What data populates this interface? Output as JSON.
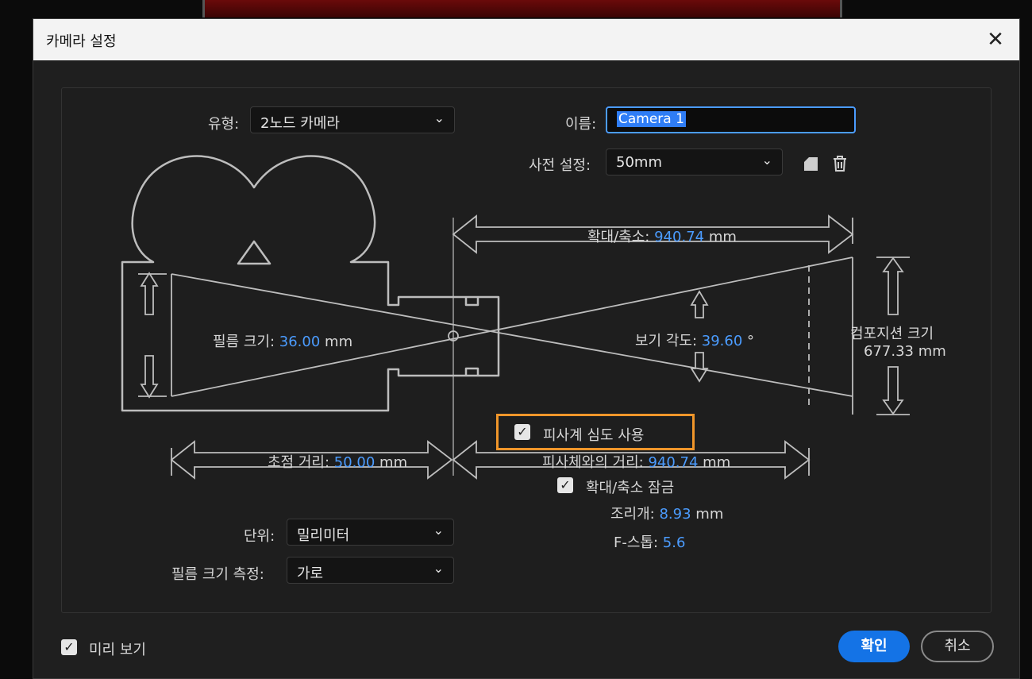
{
  "dialog": {
    "title": "카메라 설정",
    "close_glyph": "✕"
  },
  "type": {
    "label": "유형:",
    "value": "2노드 카메라"
  },
  "name": {
    "label": "이름:",
    "value": "Camera 1"
  },
  "preset": {
    "label": "사전 설정:",
    "value": "50mm"
  },
  "zoom": {
    "label": "확대/축소:",
    "value": "940.74",
    "unit": "mm"
  },
  "film_size": {
    "label": "필름 크기:",
    "value": "36.00",
    "unit": "mm"
  },
  "angle_of_view": {
    "label": "보기 각도:",
    "value": "39.60",
    "unit": "°"
  },
  "comp_size": {
    "label": "컴포지션 크기",
    "value": "677.33 mm"
  },
  "enable_dof": {
    "label": "피사계 심도 사용",
    "checked": true
  },
  "focal_length": {
    "label": "초점 거리:",
    "value": "50.00",
    "unit": "mm"
  },
  "focus_distance": {
    "label": "피사체와의 거리:",
    "value": "940.74",
    "unit": "mm"
  },
  "lock_to_zoom": {
    "label": "확대/축소 잠금",
    "checked": true
  },
  "aperture": {
    "label": "조리개:",
    "value": "8.93",
    "unit": "mm"
  },
  "fstop": {
    "label": "F-스톱:",
    "value": "5.6"
  },
  "units": {
    "label": "단위:",
    "value": "밀리미터"
  },
  "measure_film": {
    "label": "필름 크기 측정:",
    "value": "가로"
  },
  "preview": {
    "label": "미리 보기",
    "checked": true
  },
  "buttons": {
    "ok": "확인",
    "cancel": "취소"
  },
  "icons": {
    "new_preset": "new-preset-icon",
    "delete": "trash-icon",
    "chevron": "chevron-down-icon",
    "check": "checkmark-icon"
  },
  "colors": {
    "accent": "#4b9cff",
    "primary_button": "#1473e6",
    "highlight": "#f0962a",
    "line": "#bdbdbd"
  }
}
